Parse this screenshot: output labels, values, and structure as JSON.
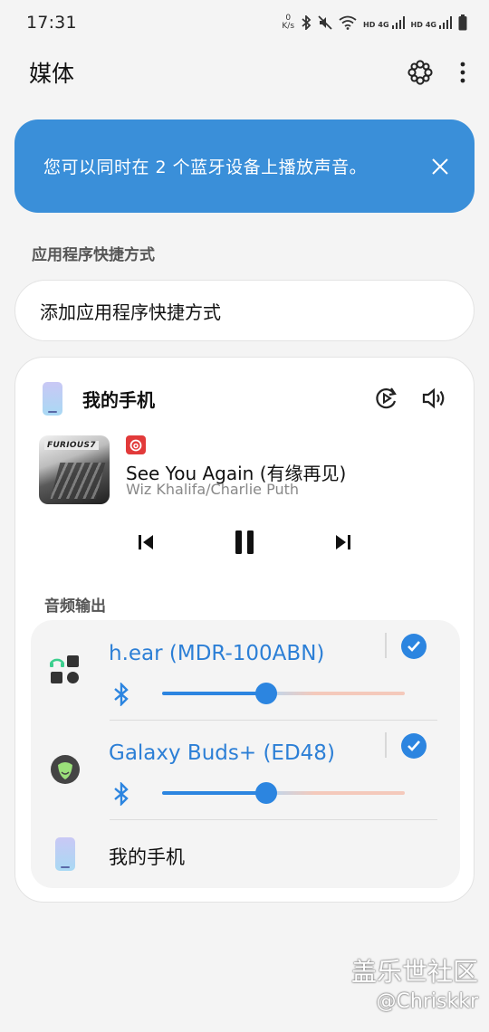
{
  "status_bar": {
    "time": "17:31",
    "net_speed_value": "0",
    "net_speed_unit": "K/s",
    "signal1_label": "HD",
    "signal1_type": "4G",
    "signal2_label": "HD",
    "signal2_type": "4G"
  },
  "header": {
    "title": "媒体"
  },
  "banner": {
    "message": "您可以同时在 2 个蓝牙设备上播放声音。"
  },
  "shortcuts": {
    "section_label": "应用程序快捷方式",
    "add_label": "添加应用程序快捷方式"
  },
  "device": {
    "name": "我的手机",
    "media": {
      "album_logo": "FURIOUS7",
      "song_title": "See You Again (有缘再见)",
      "artist": "Wiz Khalifa/Charlie Puth"
    },
    "audio_output_label": "音频输出",
    "outputs": [
      {
        "name": "h.ear (MDR-100ABN)",
        "volume": 0.43,
        "selected": true
      },
      {
        "name": "Galaxy Buds+ (ED48)",
        "volume": 0.43,
        "selected": true
      },
      {
        "name": "我的手机"
      }
    ]
  },
  "watermark": {
    "line1": "盖乐世社区",
    "line2": "@Chriskkr"
  },
  "colors": {
    "accent": "#2c85e0",
    "banner_bg": "#3a8fd9",
    "background": "#f4f4f4"
  }
}
